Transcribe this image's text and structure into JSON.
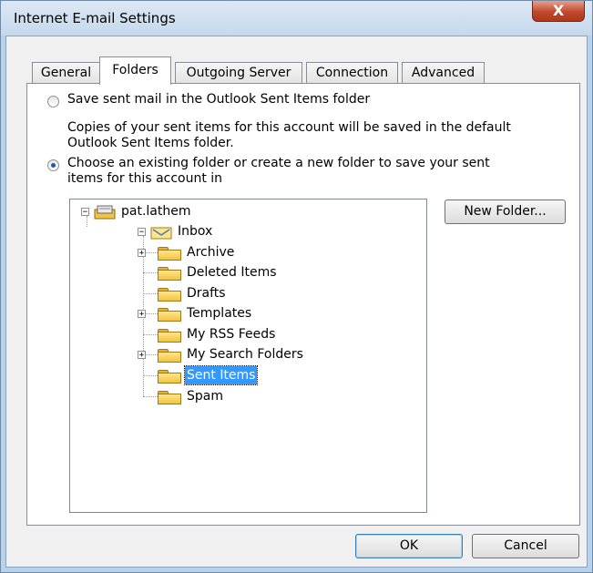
{
  "window": {
    "title": "Internet E-mail Settings",
    "close_label": "X"
  },
  "tabs": [
    {
      "label": "General",
      "active": false
    },
    {
      "label": "Folders",
      "active": true
    },
    {
      "label": "Outgoing Server",
      "active": false
    },
    {
      "label": "Connection",
      "active": false
    },
    {
      "label": "Advanced",
      "active": false
    }
  ],
  "options": {
    "save_default_label": "Save sent mail in the Outlook Sent Items folder",
    "save_default_desc_1": "Copies of your sent items for this account will be saved in the default",
    "save_default_desc_2": "Outlook Sent Items folder.",
    "choose_folder_label_1": "Choose an existing folder or create a new folder to save your sent",
    "choose_folder_label_2": "items for this account in",
    "selected": "choose_folder"
  },
  "tree": {
    "account": "pat.lathem",
    "inbox": "Inbox",
    "folders": [
      {
        "label": "Archive",
        "expandable": true
      },
      {
        "label": "Deleted Items",
        "expandable": false
      },
      {
        "label": "Drafts",
        "expandable": false
      },
      {
        "label": "Templates",
        "expandable": true
      },
      {
        "label": "My RSS Feeds",
        "expandable": false
      },
      {
        "label": "My Search Folders",
        "expandable": true
      },
      {
        "label": "Sent Items",
        "expandable": false,
        "selected": true
      },
      {
        "label": "Spam",
        "expandable": false
      }
    ]
  },
  "buttons": {
    "new_folder": "New Folder...",
    "ok": "OK",
    "cancel": "Cancel"
  },
  "colors": {
    "selection": "#3399ff",
    "title_bar": "#c5d8ec",
    "close_button": "#c0482c"
  }
}
